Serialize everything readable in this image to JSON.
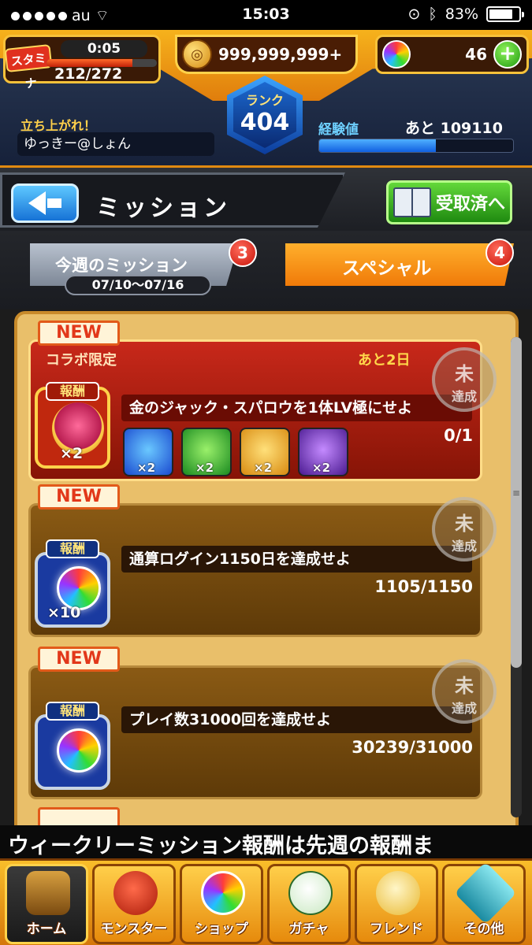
{
  "status_bar": {
    "carrier": "au",
    "time": "15:03",
    "battery": "83%"
  },
  "header": {
    "stamina_label": "スタミナ",
    "stamina_timer": "0:05",
    "stamina_count": "212/272",
    "stamina_fill": 0.78,
    "coins": "999,999,999+",
    "orbs": "46",
    "rank_label": "ランク",
    "rank": "404",
    "motto": "立ち上がれ！",
    "username": "ゆっきー@しょん",
    "exp_label": "経験値",
    "exp_remaining": "あと 109110",
    "exp_fill": 0.6
  },
  "titlebar": {
    "title": "ミッション",
    "received_label": "受取済へ"
  },
  "tabs": {
    "weekly_label": "今週のミッション",
    "weekly_dates": "07/10〜07/16",
    "weekly_badge": "3",
    "special_label": "スペシャル",
    "special_badge": "4"
  },
  "missions": [
    {
      "new": "NEW",
      "category": "コラボ限定",
      "days_left": "あと2日",
      "reward_label": "報酬",
      "title": "金のジャック・スパロウを1体LV極にせよ",
      "progress": "0/1",
      "reward_mult": "×2",
      "extra_rewards": [
        "×2",
        "×2",
        "×2",
        "×2"
      ],
      "stamp_1": "未",
      "stamp_2": "達成"
    },
    {
      "new": "NEW",
      "reward_label": "報酬",
      "title": "通算ログイン1150日を達成せよ",
      "progress": "1105/1150",
      "reward_mult": "×10",
      "stamp_1": "未",
      "stamp_2": "達成"
    },
    {
      "new": "NEW",
      "reward_label": "報酬",
      "title": "プレイ数31000回を達成せよ",
      "progress": "30239/31000",
      "stamp_1": "未",
      "stamp_2": "達成"
    }
  ],
  "ticker": "ウィークリーミッション報酬は先週の報酬ま",
  "bottom_nav": [
    {
      "label": "ホーム",
      "icon": "home-icon"
    },
    {
      "label": "モンスター",
      "icon": "monster-icon"
    },
    {
      "label": "ショップ",
      "icon": "orb-icon"
    },
    {
      "label": "ガチャ",
      "icon": "egg-icon"
    },
    {
      "label": "フレンド",
      "icon": "friends-icon"
    },
    {
      "label": "その他",
      "icon": "other-icon"
    }
  ]
}
